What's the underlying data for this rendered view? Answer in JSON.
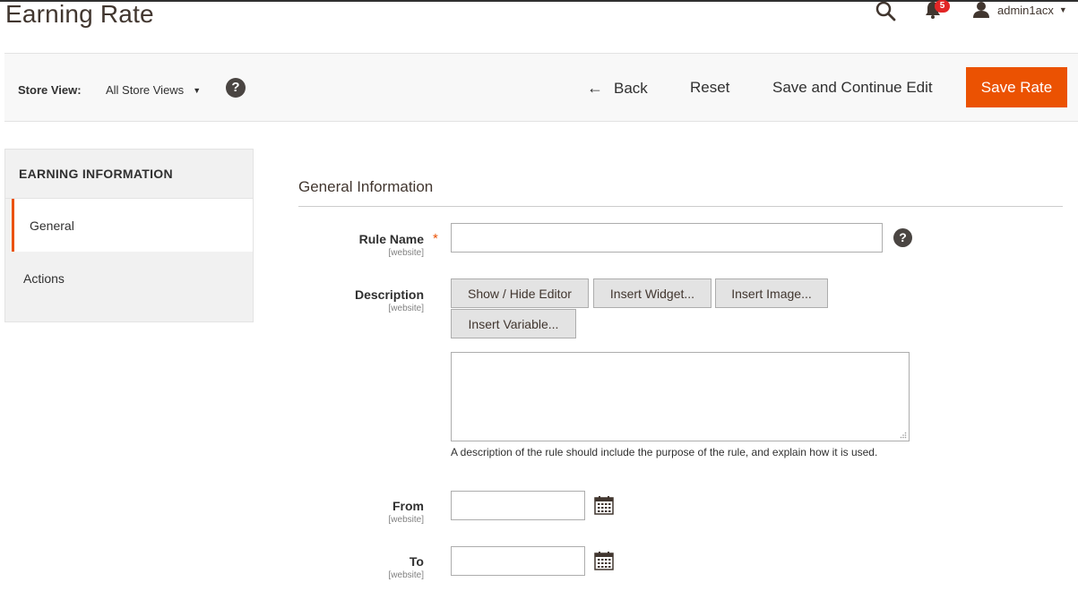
{
  "header": {
    "title": "Earning Rate",
    "notification_count": "5",
    "username": "admin1acx"
  },
  "toolbar": {
    "store_view_label": "Store View:",
    "store_view_value": "All Store Views",
    "back_label": "Back",
    "reset_label": "Reset",
    "save_continue_label": "Save and Continue Edit",
    "save_label": "Save Rate",
    "accent_color": "#eb5202"
  },
  "sidebar": {
    "title": "EARNING INFORMATION",
    "tabs": [
      {
        "label": "General",
        "active": true
      },
      {
        "label": "Actions",
        "active": false
      }
    ]
  },
  "form": {
    "section_title": "General Information",
    "rule_name": {
      "label": "Rule Name",
      "scope": "[website]",
      "value": ""
    },
    "description": {
      "label": "Description",
      "scope": "[website]",
      "value": "",
      "buttons": [
        "Show / Hide Editor",
        "Insert Widget...",
        "Insert Image...",
        "Insert Variable..."
      ],
      "note": "A description of the rule should include the purpose of the rule, and explain how it is used."
    },
    "from": {
      "label": "From",
      "scope": "[website]",
      "value": ""
    },
    "to": {
      "label": "To",
      "scope": "[website]",
      "value": ""
    }
  }
}
